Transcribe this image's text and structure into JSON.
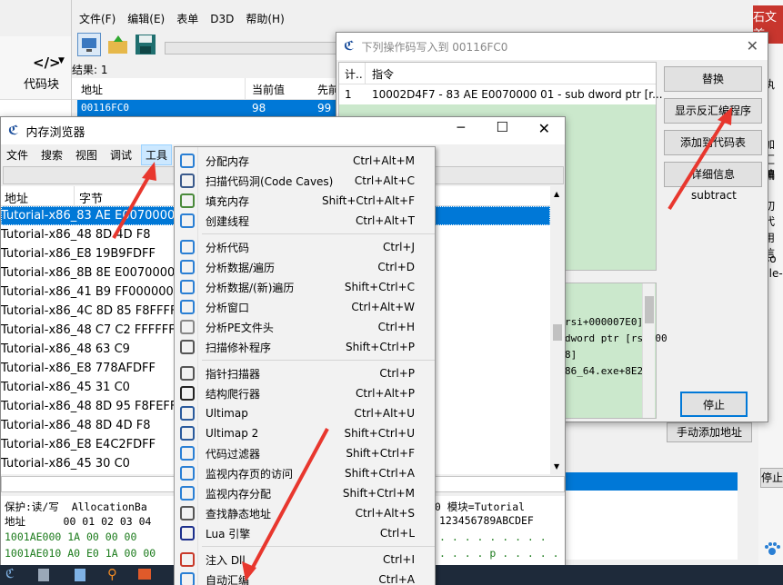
{
  "background_app": {
    "left_edge": {
      "code_icon": "</>",
      "code_label": "代码块"
    },
    "menu": [
      "文件(F)",
      "编辑(E)",
      "表单",
      "D3D",
      "帮助(H)"
    ],
    "results_label": "结果: 1",
    "table_headers": [
      "地址",
      "当前值",
      "先前"
    ],
    "table_row": {
      "address": "00116FC0",
      "current": "98",
      "previous": "99"
    },
    "right_edge_fragments": [
      "石文首",
      "执",
      "加汇编",
      "编",
      "切代",
      "用信",
      "so",
      "gle-",
      "停止"
    ],
    "add_address_button": "手动添加地址"
  },
  "opcode_dialog": {
    "title": "下列操作码写入到 00116FC0",
    "headers": [
      "计..",
      "指令"
    ],
    "rows": [
      {
        "count": "1",
        "instruction": "10002D4F7 - 83 AE E0070000 01 - sub dword ptr [r..."
      }
    ],
    "buttons": {
      "replace": "替换",
      "show_disasm": "显示反汇编程序",
      "add_to_codelist": "添加到代码表",
      "details": "详细信息",
      "stop": "停止"
    },
    "detail_label": "subtract",
    "info_lines": [
      "rsi+000007E0]",
      "dword ptr [rsi+00",
      "8]",
      "86_64.exe+8E2"
    ]
  },
  "memory_viewer": {
    "title": "内存浏览器",
    "menu": [
      "文件",
      "搜索",
      "视图",
      "调试",
      "工具"
    ],
    "headers": [
      "地址",
      "字节"
    ],
    "rows": [
      "Tutorial-x86_83 AE E0070000",
      "Tutorial-x86_48 8D 4D F8",
      "Tutorial-x86_E8 19B9FDFF",
      "Tutorial-x86_8B 8E E0070000",
      "Tutorial-x86_41 B9 FF000000",
      "Tutorial-x86_4C 8D 85 F8FFFFF",
      "Tutorial-x86_48 C7 C2 FFFFFFF",
      "Tutorial-x86_48 63 C9",
      "Tutorial-x86_E8 778AFDFF",
      "Tutorial-x86_45 31 C0",
      "Tutorial-x86_48 8D 95 F8FEFFF",
      "Tutorial-x86_48 8D 4D F8",
      "Tutorial-x86_E8 E4C2FDFF",
      "Tutorial-x86_45 30 C0"
    ],
    "hex_header_1": "保护:读/写  AllocationBa",
    "hex_header_1_right": "00 模块=Tutorial",
    "hex_header_2": "地址      00 01 02 03 04",
    "hex_header_2_right": "123456789ABCDEF",
    "hex_rows": [
      "1001AE000 1A 00 00 00",
      "1001AE010 A0 E0 1A 00 00"
    ],
    "hex_ascii_rows": [
      ". . . . . . . . .",
      ". . . . p . . . . ."
    ]
  },
  "tools_menu": {
    "items": [
      {
        "label": "分配内存",
        "shortcut": "Ctrl+Alt+M",
        "icon": "plus-icon"
      },
      {
        "label": "扫描代码洞(Code Caves)",
        "shortcut": "Ctrl+Alt+C",
        "icon": "null-icon"
      },
      {
        "label": "填充内存",
        "shortcut": "Shift+Ctrl+Alt+F",
        "icon": "chip-icon"
      },
      {
        "label": "创建线程",
        "shortcut": "Ctrl+Alt+T",
        "icon": "thread-icon"
      },
      {
        "sep": true
      },
      {
        "label": "分析代码",
        "shortcut": "Ctrl+J",
        "icon": "eye-icon"
      },
      {
        "label": "分析数据/遍历",
        "shortcut": "Ctrl+D",
        "icon": "data-icon"
      },
      {
        "label": "分析数据/(新)遍历",
        "shortcut": "Shift+Ctrl+C",
        "icon": "data-new-icon"
      },
      {
        "label": "分析窗口",
        "shortcut": "Ctrl+Alt+W",
        "icon": "window-icon"
      },
      {
        "label": "分析PE文件头",
        "shortcut": "Ctrl+H",
        "icon": "pe-icon"
      },
      {
        "label": "扫描修补程序",
        "shortcut": "Shift+Ctrl+P",
        "icon": "patch-icon"
      },
      {
        "sep": true
      },
      {
        "label": "指针扫描器",
        "shortcut": "Ctrl+P",
        "icon": "magnifier-icon"
      },
      {
        "label": "结构爬行器",
        "shortcut": "Ctrl+Alt+P",
        "icon": "spider-icon"
      },
      {
        "label": "Ultimap",
        "shortcut": "Ctrl+Alt+U",
        "icon": "ultimap-icon"
      },
      {
        "label": "Ultimap 2",
        "shortcut": "Shift+Ctrl+U",
        "icon": "ultimap2-icon"
      },
      {
        "label": "代码过滤器",
        "shortcut": "Shift+Ctrl+F",
        "icon": "filter-icon"
      },
      {
        "label": "监视内存页的访问",
        "shortcut": "Shift+Ctrl+A",
        "icon": "watch-icon"
      },
      {
        "label": "监视内存分配",
        "shortcut": "Shift+Ctrl+M",
        "icon": "watch-alloc-icon"
      },
      {
        "label": "查找静态地址",
        "shortcut": "Ctrl+Alt+S",
        "icon": "find-icon"
      },
      {
        "label": "Lua 引擎",
        "shortcut": "Ctrl+L",
        "icon": "lua-icon"
      },
      {
        "sep": true
      },
      {
        "label": "注入 Dll",
        "shortcut": "Ctrl+I",
        "icon": "inject-icon"
      },
      {
        "label": "自动汇编",
        "shortcut": "Ctrl+A",
        "icon": "autoasm-icon"
      }
    ]
  },
  "colors": {
    "selection": "#0078d7",
    "list_green": "#cbe8cc",
    "arrow": "#e8372e"
  }
}
